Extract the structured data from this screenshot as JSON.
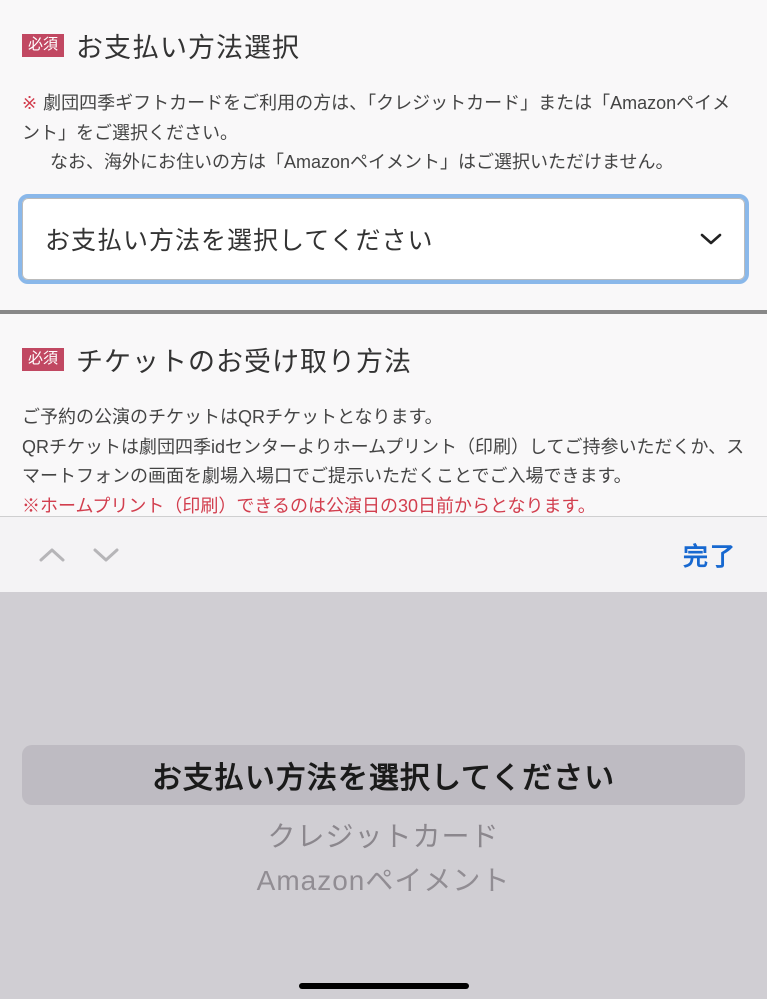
{
  "payment_section": {
    "required_badge": "必須",
    "title": "お支払い方法選択",
    "note_asterisk": "※",
    "note_line1": "劇団四季ギフトカードをご利用の方は、「クレジットカード」または「Amazonペイメント」をご選択ください。",
    "note_line2": "なお、海外にお住いの方は「Amazonペイメント」はご選択いただけません。",
    "select_value": "お支払い方法を選択してください"
  },
  "ticket_section": {
    "required_badge": "必須",
    "title": "チケットのお受け取り方法",
    "desc_line1": "ご予約の公演のチケットはQRチケットとなります。",
    "desc_line2": "QRチケットは劇団四季idセンターよりホームプリント（印刷）してご持参いただくか、スマートフォンの画面を劇場入場口でご提示いただくことでご入場できます。",
    "desc_line3": "※ホームプリント（印刷）できるのは公演日の30日前からとなります。"
  },
  "accessory": {
    "done": "完了"
  },
  "picker": {
    "selected": "お支払い方法を選択してください",
    "options": [
      "クレジットカード",
      "Amazonペイメント"
    ]
  }
}
